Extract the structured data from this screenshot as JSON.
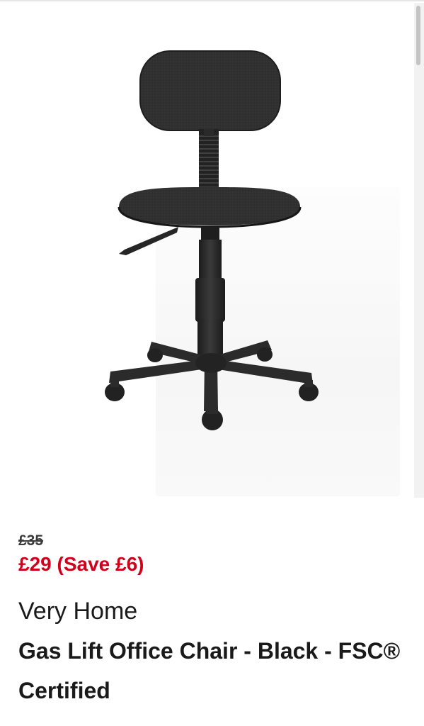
{
  "product": {
    "image_alt": "Gas Lift Office Chair - Black",
    "was_price": "£35",
    "now_price": "£29 (Save £6)",
    "brand": "Very Home",
    "title": "Gas Lift Office Chair - Black - FSC® Certified"
  },
  "colors": {
    "sale_red": "#d0021b",
    "text_dark": "#1a1a1a",
    "chair_fabric": "#2f2f2f",
    "chair_plastic": "#2b2b2b"
  }
}
